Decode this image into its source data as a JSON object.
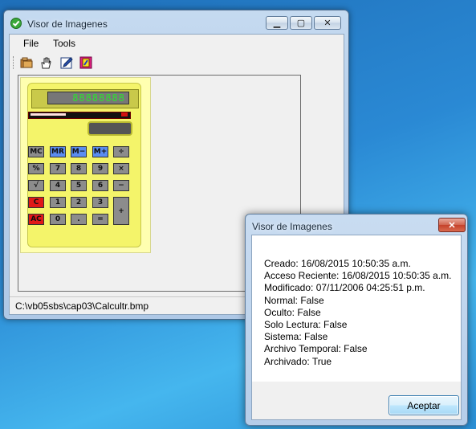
{
  "main_window": {
    "title": "Visor de Imagenes",
    "controls": {
      "minimize": "▁",
      "maximize": "▢",
      "close": "✕"
    },
    "menu": [
      "File",
      "Tools"
    ],
    "toolbar_icons": [
      "folder-open-icon",
      "hand-icon",
      "edit-icon",
      "properties-icon"
    ],
    "status_path": "C:\\vb05sbs\\cap03\\Calcultr.bmp"
  },
  "calculator_image": {
    "display": "88888888",
    "keys": [
      [
        "MC",
        "MR",
        "M−",
        "M+",
        "÷"
      ],
      [
        "%",
        "7",
        "8",
        "9",
        "×"
      ],
      [
        "√",
        "4",
        "5",
        "6",
        "−"
      ],
      [
        "C",
        "1",
        "2",
        "3",
        "+"
      ],
      [
        "AC",
        "0",
        ".",
        "=",
        ""
      ]
    ]
  },
  "dialog": {
    "title": "Visor de Imagenes",
    "close_label": "✕",
    "lines": [
      "Creado: 16/08/2015 10:50:35 a.m.",
      "Acceso Reciente: 16/08/2015 10:50:35 a.m.",
      "Modificado: 07/11/2006 04:25:51 p.m.",
      "Normal: False",
      "Oculto: False",
      "Solo Lectura: False",
      "Sistema: False",
      "Archivo Temporal: False",
      "Archivado: True"
    ],
    "ok_label": "Aceptar"
  },
  "colors": {
    "desktop": "#2a89d4",
    "titlebar": "#b8d0eb",
    "calc_yellow": "#f4f46a",
    "key_blue": "#5a8cf0",
    "key_red": "#e01818",
    "key_gray": "#8c8c8c",
    "lcd_green": "#2ee02e"
  }
}
